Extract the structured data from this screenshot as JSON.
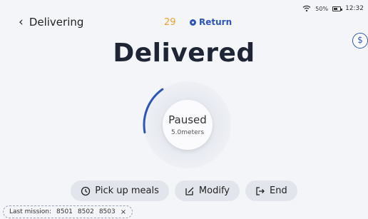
{
  "status": {
    "battery_pct": "50%",
    "time": "12:32"
  },
  "header": {
    "back_label": "Delivering",
    "count": "29",
    "return_label": "Return",
    "side_label": "$"
  },
  "main": {
    "title": "Delivered",
    "dial_state": "Paused",
    "dial_distance": "5.0meters",
    "progress": 0.18
  },
  "actions": [
    {
      "label": "Pick up meals",
      "icon": "clock-icon"
    },
    {
      "label": "Modify",
      "icon": "edit-icon"
    },
    {
      "label": "End",
      "icon": "exit-icon"
    }
  ],
  "last_mission": {
    "label": "Last mission:",
    "ids": [
      "8501",
      "8502",
      "8503"
    ],
    "close": "×"
  },
  "colors": {
    "accent": "#2d55b8",
    "count": "#f0a030",
    "background": "#f4f5f8"
  }
}
